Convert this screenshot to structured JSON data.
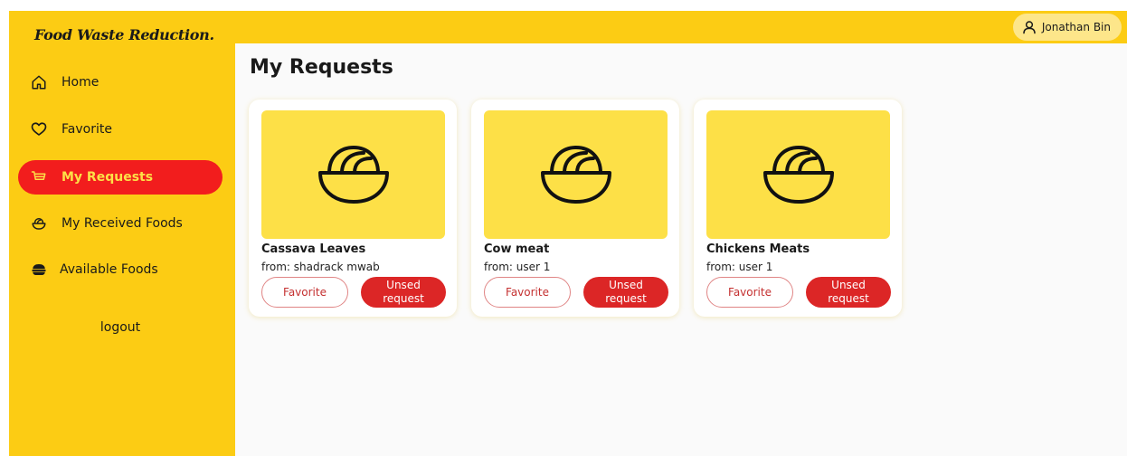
{
  "brand": {
    "title": "Food Waste Reduction."
  },
  "sidebar": {
    "items": [
      {
        "label": "Home",
        "icon": "home-icon",
        "active": false
      },
      {
        "label": "Favorite",
        "icon": "heart-icon",
        "active": false
      },
      {
        "label": "My Requests",
        "icon": "cart-icon",
        "active": true
      },
      {
        "label": "My Received Foods",
        "icon": "bowl-icon",
        "active": false
      },
      {
        "label": "Available Foods",
        "icon": "food-icon",
        "active": false
      }
    ],
    "logout_label": "logout"
  },
  "header": {
    "user_name": "Jonathan Bin",
    "user_icon": "user-icon"
  },
  "main": {
    "title": "My Requests",
    "cards": [
      {
        "name": "Cassava Leaves",
        "from": "from: shadrack mwab",
        "favorite_label": "Favorite",
        "request_label_line1": "Unsed",
        "request_label_line2": "request",
        "image_icon": "noodle-bowl-icon"
      },
      {
        "name": "Cow meat",
        "from": "from: user 1",
        "favorite_label": "Favorite",
        "request_label_line1": "Unsed",
        "request_label_line2": "request",
        "image_icon": "noodle-bowl-icon"
      },
      {
        "name": "Chickens Meats",
        "from": "from: user 1",
        "favorite_label": "Favorite",
        "request_label_line1": "Unsed",
        "request_label_line2": "request",
        "image_icon": "noodle-bowl-icon"
      }
    ]
  },
  "colors": {
    "sidebar_bg": "#fccc14",
    "active_bg": "#f21d1d",
    "active_text": "#fde047",
    "card_image_bg": "#fde047",
    "request_button": "#dc2626"
  }
}
